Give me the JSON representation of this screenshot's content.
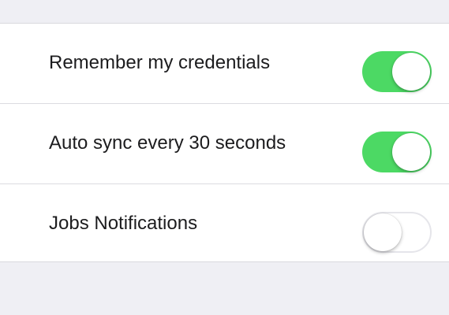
{
  "colors": {
    "toggle_on": "#4cd964",
    "toggle_off_border": "#e5e5ea",
    "group_background": "#ffffff",
    "page_background": "#efeff4"
  },
  "settings": [
    {
      "label": "Remember my credentials",
      "enabled": true
    },
    {
      "label": "Auto sync every 30 seconds",
      "enabled": true
    },
    {
      "label": "Jobs Notifications",
      "enabled": false
    }
  ]
}
